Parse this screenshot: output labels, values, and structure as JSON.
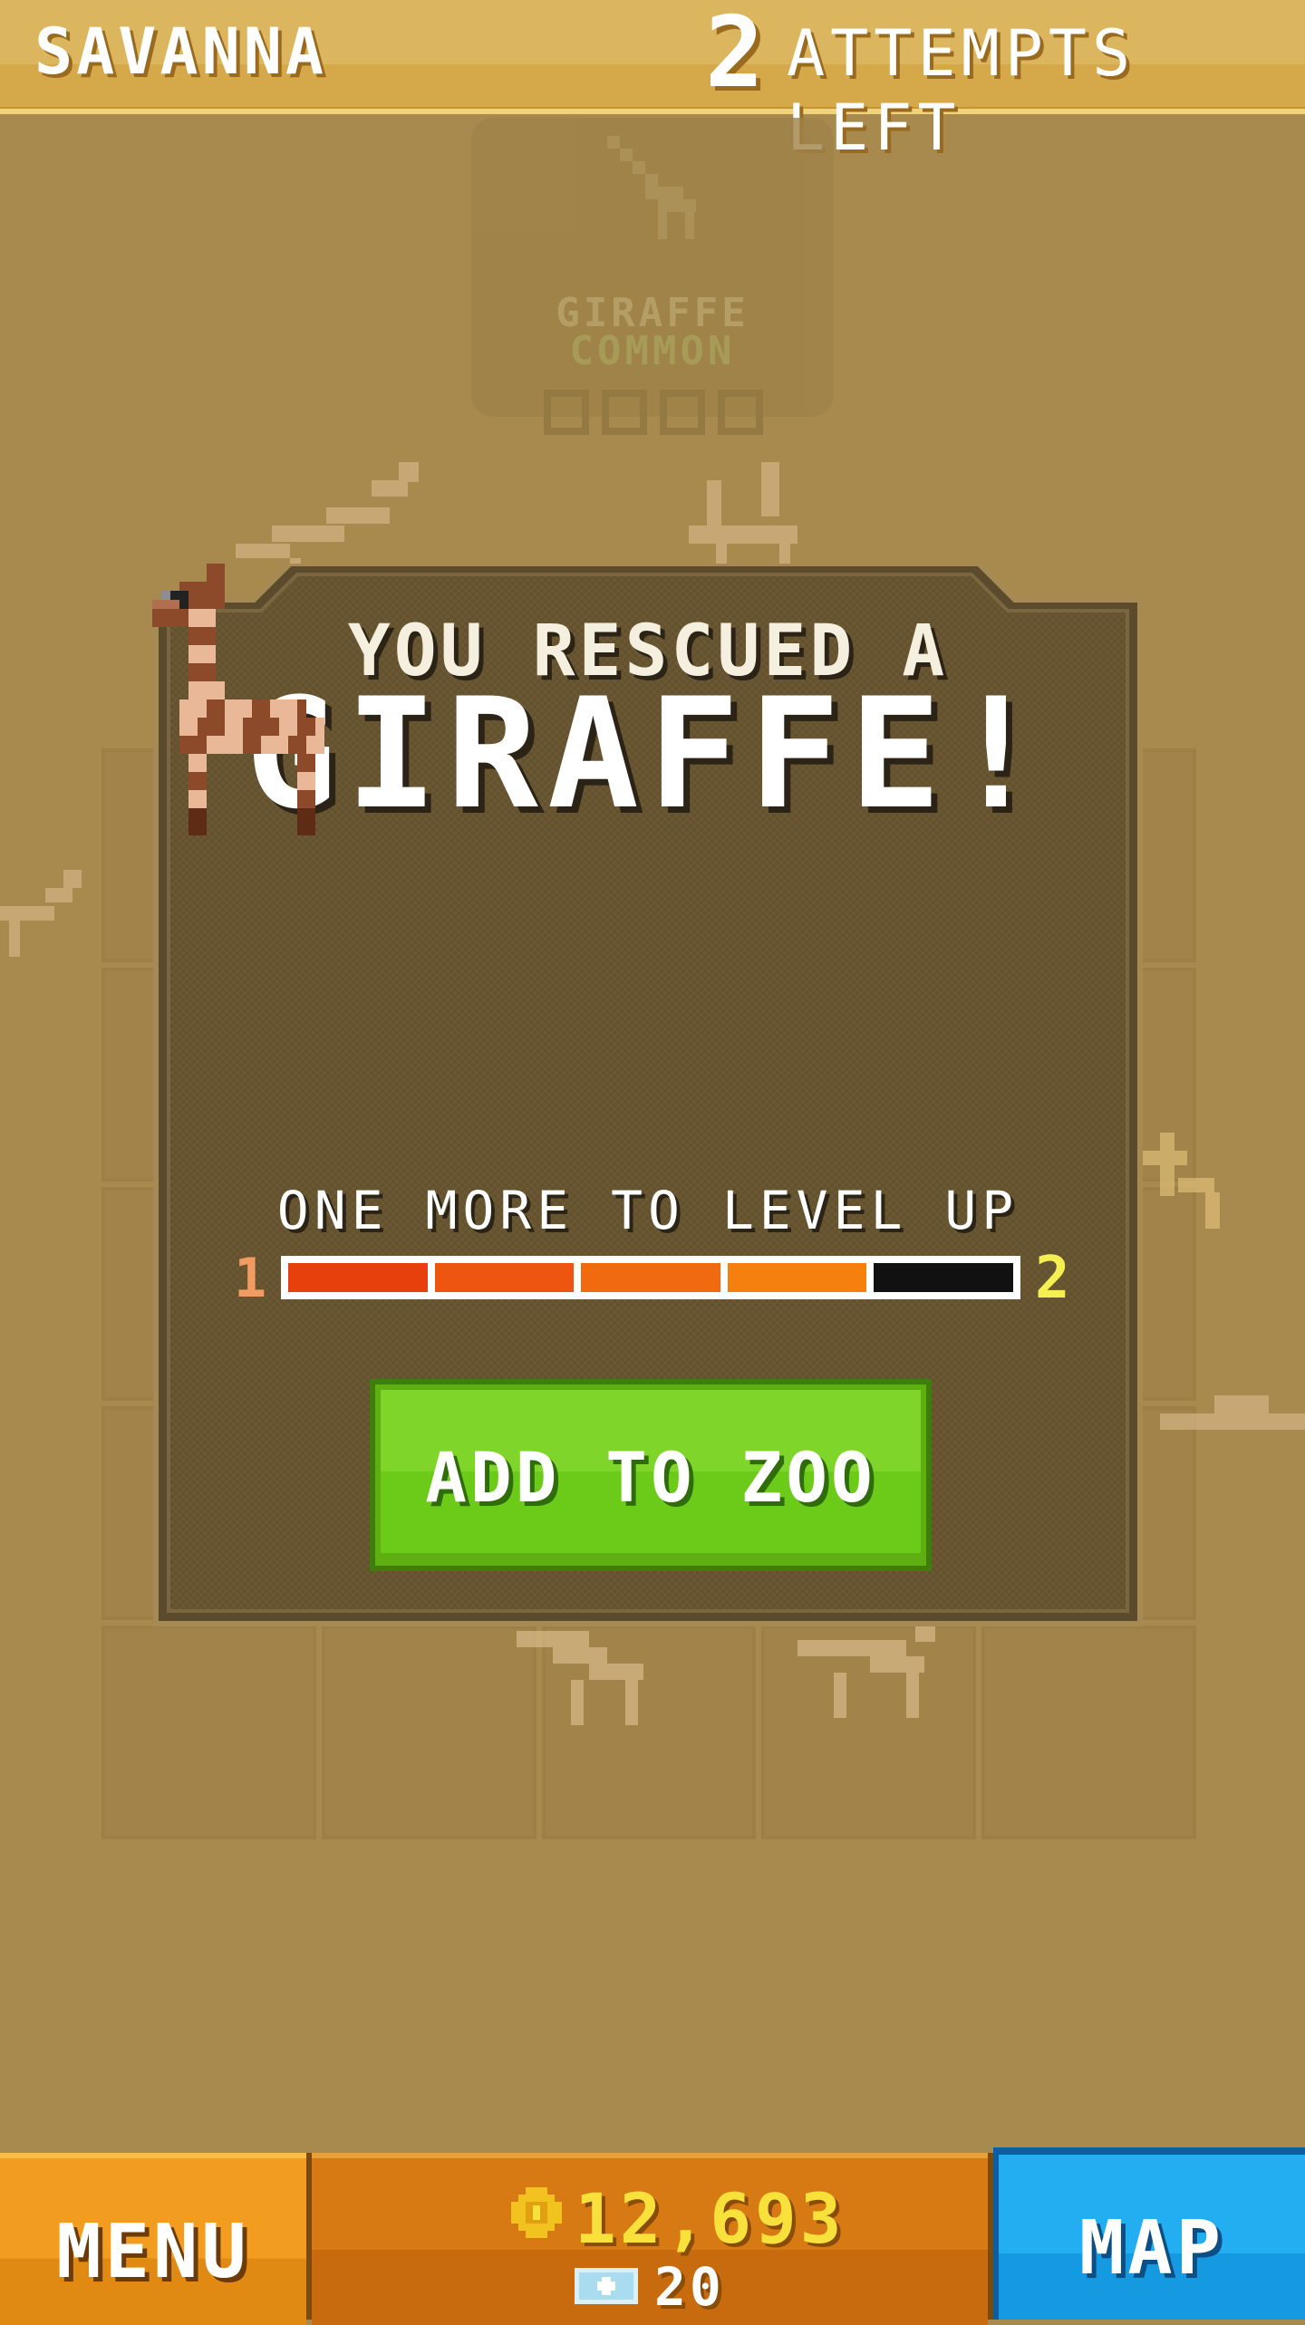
{
  "header": {
    "region": "SAVANNA",
    "attempts_count": "2",
    "attempts_label": "ATTEMPTS LEFT"
  },
  "background_card": {
    "animal": "GIRAFFE",
    "rarity": "COMMON"
  },
  "dialog": {
    "title_small": "YOU RESCUED A",
    "title_big": "GIRAFFE!",
    "animal_icon": "giraffe-icon",
    "levelup_text": "ONE MORE TO LEVEL UP",
    "level_from": "1",
    "level_to": "2",
    "progress": {
      "filled": 4,
      "total": 5
    },
    "progress_colors": [
      "#e8400c",
      "#ee5510",
      "#f26a10",
      "#f5800e"
    ],
    "add_button_label": "ADD TO ZOO"
  },
  "footer": {
    "menu_label": "MENU",
    "coins": "12,693",
    "tickets": "20",
    "map_label": "MAP"
  },
  "colors": {
    "background": "#a98a4e",
    "dialog_panel": "#6a5834",
    "button_green": "#6bcb18",
    "menu_orange": "#f29d1f",
    "map_blue": "#22aef0"
  }
}
